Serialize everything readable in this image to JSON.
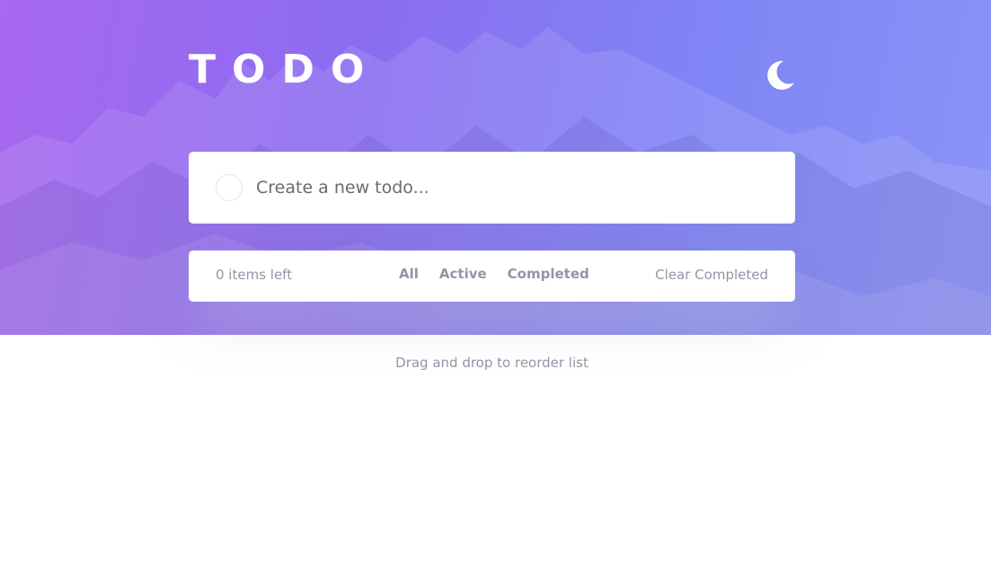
{
  "app": {
    "title": "TODO"
  },
  "theme_toggle": {
    "icon": "moon-icon"
  },
  "new_todo": {
    "placeholder": "Create a new todo..."
  },
  "footer": {
    "items_left": "0 items left",
    "filters": [
      "All",
      "Active",
      "Completed"
    ],
    "clear_label": "Clear Completed"
  },
  "hint": "Drag and drop to reorder list",
  "colors": {
    "gradient_start": "#a868ef",
    "gradient_end": "#8a93f6",
    "text_muted": "#9495a5",
    "card_bg": "#ffffff"
  }
}
